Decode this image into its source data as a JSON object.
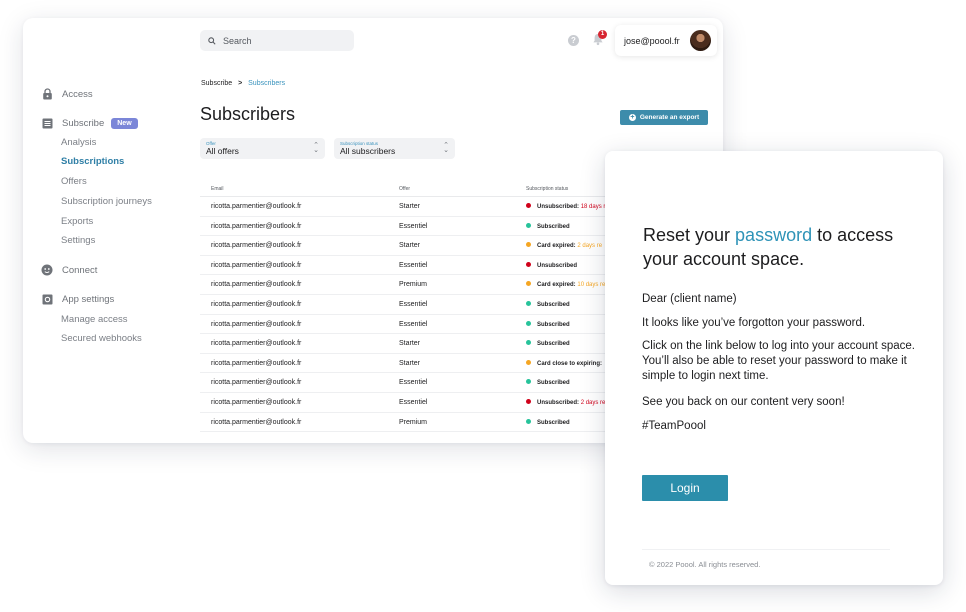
{
  "header": {
    "search_placeholder": "Search",
    "notification_count": "1",
    "help_glyph": "?",
    "user_email": "jose@poool.fr"
  },
  "sidebar": {
    "access": "Access",
    "subscribe": "Subscribe",
    "new_badge": "New",
    "subscribe_items": [
      "Analysis",
      "Subscriptions",
      "Offers",
      "Subscription journeys",
      "Exports",
      "Settings"
    ],
    "connect": "Connect",
    "app_settings": "App settings",
    "app_settings_items": [
      "Manage access",
      "Secured webhooks"
    ]
  },
  "breadcrumb": {
    "parent": "Subscribe",
    "separator": ">",
    "current": "Subscribers"
  },
  "page": {
    "title": "Subscribers",
    "export_button": "Generate an export"
  },
  "filters": {
    "offer": {
      "label": "Offer",
      "value": "All offers"
    },
    "status": {
      "label": "Subscription status",
      "value": "All subscribers"
    }
  },
  "table": {
    "headers": {
      "email": "Email",
      "offer": "Offer",
      "status": "Subscription status"
    },
    "status_colors": {
      "red": "#d0021b",
      "green": "#27c39a",
      "orange": "#f5a623"
    },
    "rows": [
      {
        "email": "ricotta.parmentier@outlook.fr",
        "offer": "Starter",
        "status": "Unsubscribed:",
        "extra": "18 days r",
        "color": "red"
      },
      {
        "email": "ricotta.parmentier@outlook.fr",
        "offer": "Essentiel",
        "status": "Subscribed",
        "extra": "",
        "color": "green"
      },
      {
        "email": "ricotta.parmentier@outlook.fr",
        "offer": "Starter",
        "status": "Card expired:",
        "extra": "2 days re",
        "color": "orange"
      },
      {
        "email": "ricotta.parmentier@outlook.fr",
        "offer": "Essentiel",
        "status": "Unsubscribed",
        "extra": "",
        "color": "red"
      },
      {
        "email": "ricotta.parmentier@outlook.fr",
        "offer": "Premium",
        "status": "Card expired:",
        "extra": "10 days re",
        "color": "orange"
      },
      {
        "email": "ricotta.parmentier@outlook.fr",
        "offer": "Essentiel",
        "status": "Subscribed",
        "extra": "",
        "color": "green"
      },
      {
        "email": "ricotta.parmentier@outlook.fr",
        "offer": "Essentiel",
        "status": "Subscribed",
        "extra": "",
        "color": "green"
      },
      {
        "email": "ricotta.parmentier@outlook.fr",
        "offer": "Starter",
        "status": "Subscribed",
        "extra": "",
        "color": "green"
      },
      {
        "email": "ricotta.parmentier@outlook.fr",
        "offer": "Starter",
        "status": "Card close to expiring:",
        "extra": "",
        "color": "orange"
      },
      {
        "email": "ricotta.parmentier@outlook.fr",
        "offer": "Essentiel",
        "status": "Subscribed",
        "extra": "",
        "color": "green"
      },
      {
        "email": "ricotta.parmentier@outlook.fr",
        "offer": "Essentiel",
        "status": "Unsubscribed:",
        "extra": "2 days re",
        "color": "red"
      },
      {
        "email": "ricotta.parmentier@outlook.fr",
        "offer": "Premium",
        "status": "Subscribed",
        "extra": "",
        "color": "green"
      }
    ]
  },
  "email": {
    "heading_pre": "Reset your ",
    "heading_highlight": "password",
    "heading_post": " to access your account space.",
    "greeting": "Dear (client name)",
    "p1": "It looks like you’ve forgotton your password.",
    "p2": "Click on the link below to log into your account space. You’ll also be able to reset your password to make it simple to login next time.",
    "p3": "See you back on our content very soon!",
    "p4": "#TeamPoool",
    "button": "Login",
    "footer": "© 2022 Poool. All rights reserved."
  }
}
